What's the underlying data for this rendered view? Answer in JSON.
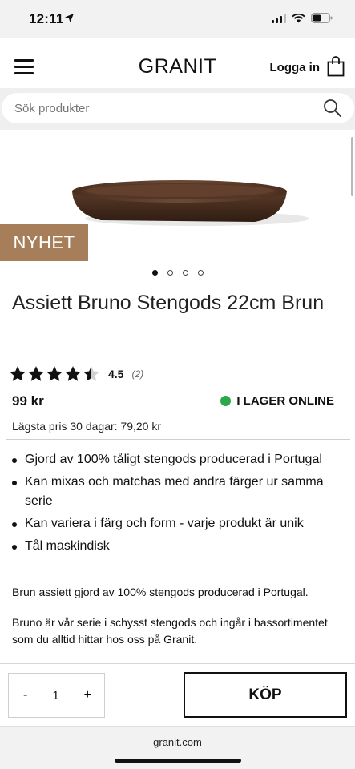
{
  "status_bar": {
    "time": "12:11"
  },
  "header": {
    "logo": "GRANIT",
    "login_label": "Logga in"
  },
  "search": {
    "placeholder": "Sök produkter"
  },
  "hero": {
    "badge": "NYHET",
    "image_count": 4,
    "active_image": 1
  },
  "product": {
    "title": "Assiett Bruno Stengods 22cm Brun",
    "rating": {
      "value": "4.5",
      "count": "(2)",
      "stars_out_of_5": 4.5
    },
    "price": "99 kr",
    "stock_label": "I LAGER ONLINE",
    "stock_color": "#2aa84a",
    "lowest_price": "Lägsta pris 30 dagar: 79,20 kr",
    "bullets": [
      "Gjord av 100% tåligt stengods producerad i Portugal",
      "Kan mixas och matchas med andra färger ur samma serie",
      "Kan variera i färg och form - varje produkt är unik",
      "Tål maskindisk"
    ],
    "description_1": "Brun assiett gjord av 100% stengods producerad i Portugal.",
    "description_2": "Bruno är vår serie i schysst stengods och ingår i bassortimentet som du alltid hittar hos oss på Granit."
  },
  "purchase": {
    "minus_label": "-",
    "quantity": "1",
    "plus_label": "+",
    "buy_label": "KÖP"
  },
  "browser": {
    "domain": "granit.com"
  },
  "colors": {
    "badge": "#a77e5a",
    "in_stock": "#2aa84a"
  }
}
